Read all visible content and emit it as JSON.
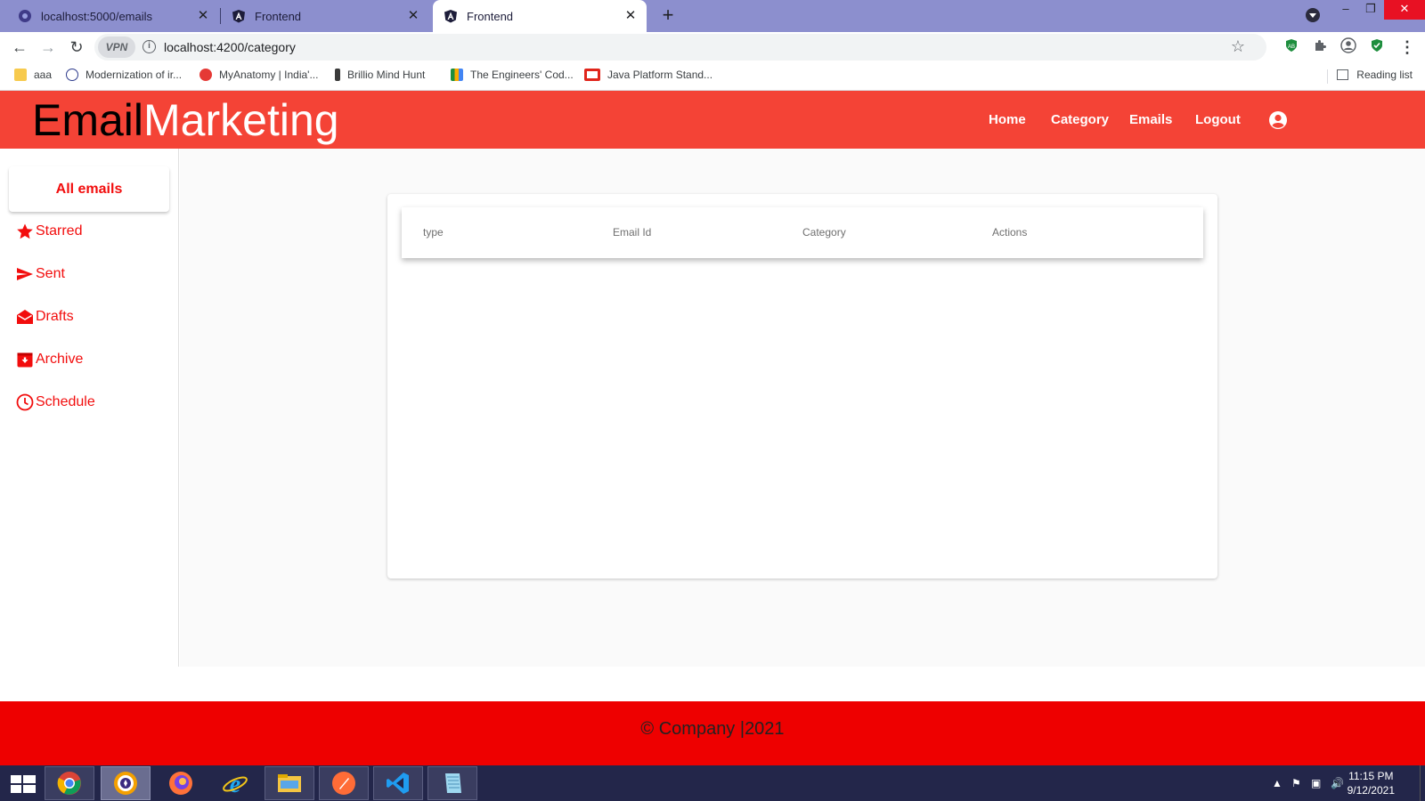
{
  "browser": {
    "tabs": [
      {
        "title": "localhost:5000/emails",
        "icon": "globe-icon"
      },
      {
        "title": "Frontend",
        "icon": "angular-icon"
      },
      {
        "title": "Frontend",
        "icon": "angular-icon",
        "active": true
      }
    ],
    "close_glyph": "✕",
    "new_tab_glyph": "+",
    "vpn_label": "VPN",
    "url": "localhost:4200/category",
    "bookmarks": [
      {
        "label": "aaa",
        "icon": "folder-icon"
      },
      {
        "label": "Modernization of ir...",
        "icon": "site-icon"
      },
      {
        "label": "MyAnatomy | India'...",
        "icon": "myanatomy-icon"
      },
      {
        "label": "Brillio Mind Hunt",
        "icon": "brillio-icon"
      },
      {
        "label": "The Engineers' Cod...",
        "icon": "chart-icon"
      },
      {
        "label": "Java Platform Stand...",
        "icon": "oracle-icon"
      }
    ],
    "reading_list": "Reading list",
    "colors": {
      "tabbar": "#8c8fce",
      "omnibox": "#f1f3f4"
    }
  },
  "app": {
    "brand_part1": "Email",
    "brand_part2": "Marketing",
    "nav": [
      "Home",
      "Category",
      "Emails",
      "Logout"
    ],
    "colors": {
      "header": "#f44336",
      "accent": "#f20d0d",
      "footer": "#ee0000"
    }
  },
  "sidebar": {
    "all_emails": "All emails",
    "items": [
      {
        "label": "Starred",
        "icon": "star-icon"
      },
      {
        "label": "Sent",
        "icon": "send-icon"
      },
      {
        "label": "Drafts",
        "icon": "drafts-icon"
      },
      {
        "label": "Archive",
        "icon": "archive-icon"
      },
      {
        "label": "Schedule",
        "icon": "clock-icon"
      }
    ]
  },
  "table": {
    "columns": [
      "type",
      "Email Id",
      "Category",
      "Actions"
    ],
    "rows": []
  },
  "footer": {
    "text": "© Company |2021"
  },
  "taskbar": {
    "apps": [
      "chrome",
      "brave",
      "firefox",
      "internet-explorer",
      "file-explorer",
      "postman",
      "vscode",
      "notepad"
    ],
    "time": "11:15 PM",
    "date": "9/12/2021"
  }
}
